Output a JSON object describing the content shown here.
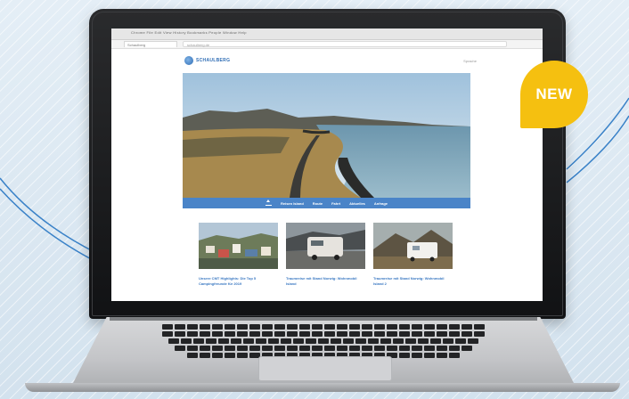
{
  "badge": {
    "label": "NEW"
  },
  "browser": {
    "menu": "Chrome   File   Edit   View   History   Bookmarks   People   Window   Help",
    "tab_label": "Schaulberg",
    "url": "schaulberg.de"
  },
  "site": {
    "logo_text": "SCHAULBERG",
    "language": "Sprache",
    "nav": [
      "Reisen Island",
      "Route",
      "Fahrt",
      "Aktuelles",
      "Anfrage"
    ],
    "cards": [
      {
        "title": "Unsere CMT Highlights: Die Top 5 Campingfreunde für 2019"
      },
      {
        "title": "Traumreise mit Stand Norwig: Wohnmobil Island"
      },
      {
        "title": "Traumreise mit Stand Norwig: Wohnmobil Island 2"
      }
    ]
  },
  "colors": {
    "accent": "#4a84c8",
    "badge": "#f5c010",
    "link": "#3a78c2"
  },
  "icons": [
    "home-icon",
    "logo-icon",
    "browser-dots-icon"
  ]
}
